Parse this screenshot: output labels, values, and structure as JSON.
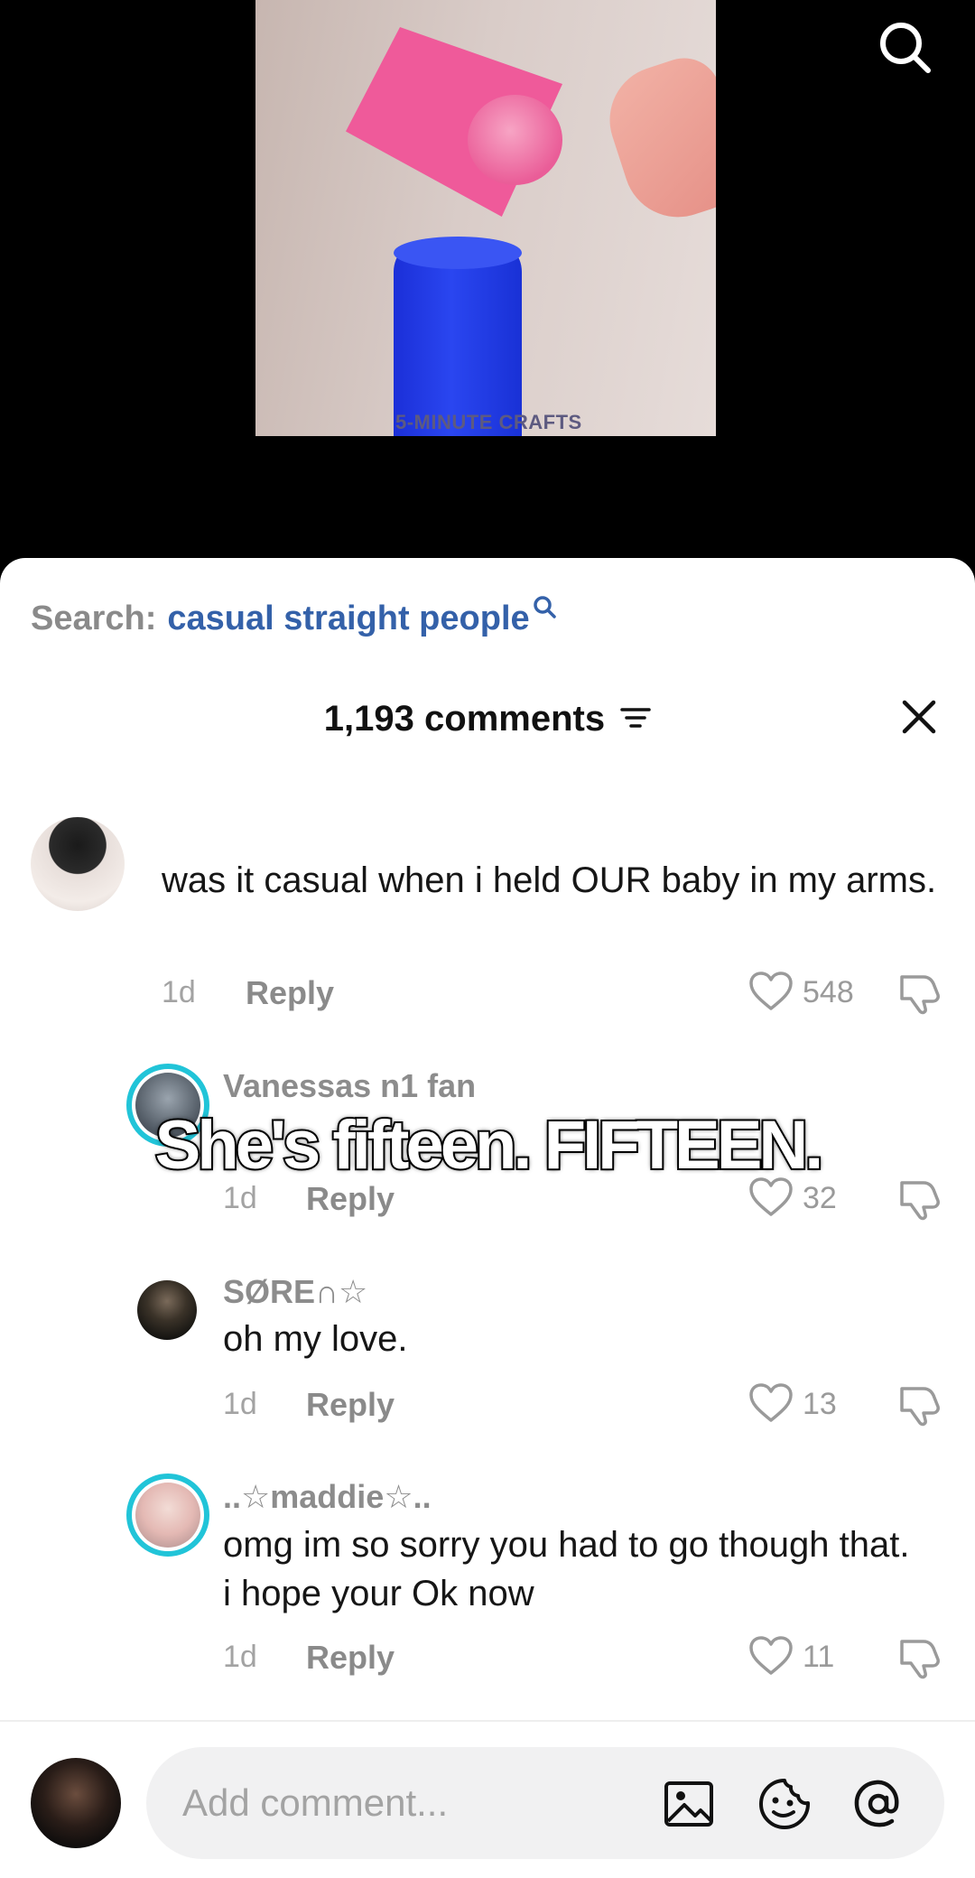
{
  "video": {
    "watermark": "5-MINUTE CRAFTS",
    "search_icon": "search-icon"
  },
  "search_suggestion": {
    "prefix": "Search:",
    "term": "casual straight people"
  },
  "comments_header": {
    "count_label": "1,193 comments",
    "filter_icon": "filter-icon",
    "close_icon": "close-icon"
  },
  "caption_overlay": "She's fifteen. FIFTEEN.",
  "comments": [
    {
      "username": "",
      "text": "was it casual when i held OUR baby in my arms.",
      "time": "1d",
      "reply_label": "Reply",
      "likes": "548"
    },
    {
      "username": "Vanessas n1 fan",
      "text": "",
      "time": "1d",
      "reply_label": "Reply",
      "likes": "32"
    },
    {
      "username": "SØRE∩☆",
      "text": "oh my love.",
      "time": "1d",
      "reply_label": "Reply",
      "likes": "13"
    },
    {
      "username": "..☆maddie☆..",
      "text": "omg im so sorry you had to go though that. i hope your Ok now",
      "time": "1d",
      "reply_label": "Reply",
      "likes": "11"
    }
  ],
  "input": {
    "placeholder": "Add comment...",
    "icons": [
      "image-icon",
      "emoji-icon",
      "mention-icon"
    ]
  },
  "colors": {
    "link_blue": "#3461a9",
    "story_ring": "#21c4d8",
    "muted_text": "#8a8a8a"
  }
}
